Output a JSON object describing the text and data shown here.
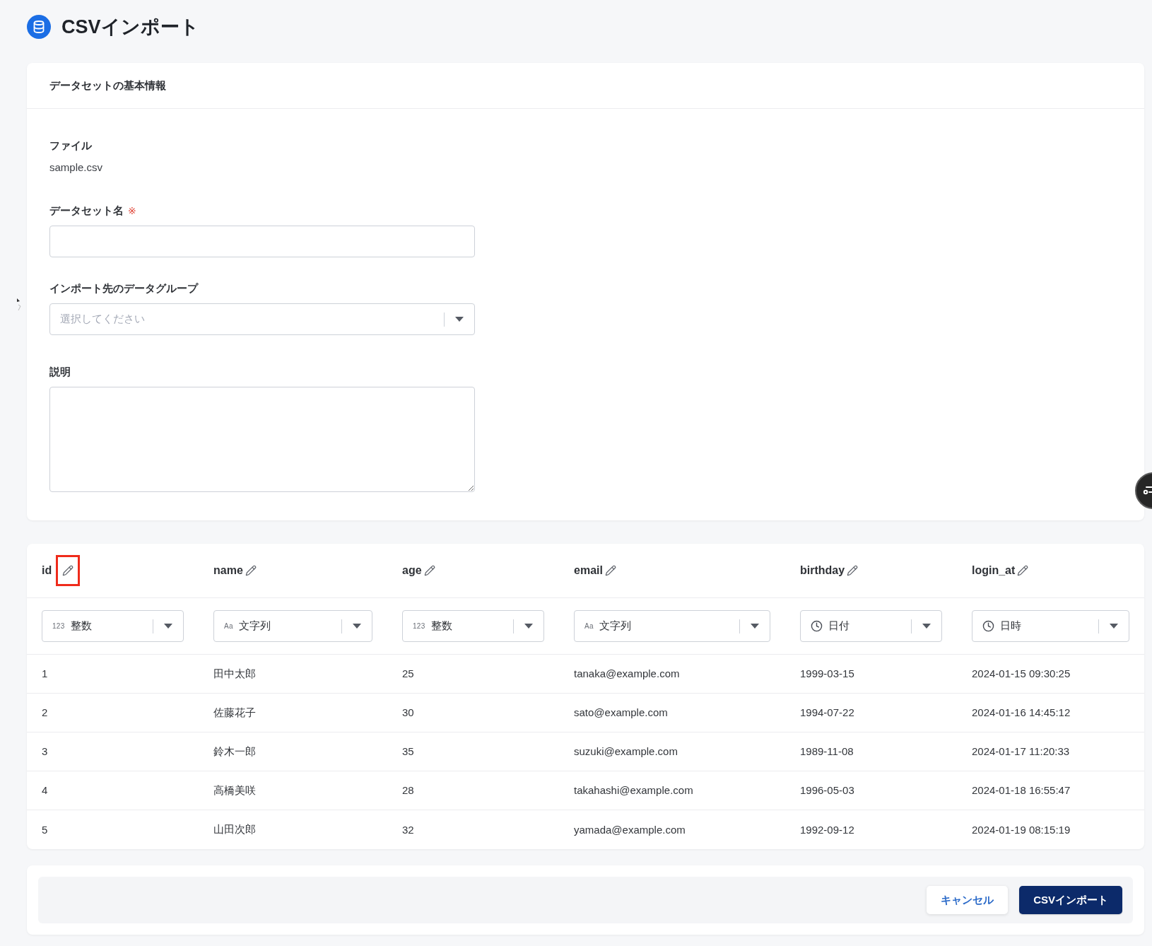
{
  "page": {
    "title": "CSVインポート"
  },
  "basic_info": {
    "heading": "データセットの基本情報",
    "file": {
      "label": "ファイル",
      "value": "sample.csv"
    },
    "dataset_name": {
      "label": "データセット名",
      "required_mark": "※"
    },
    "data_group": {
      "label": "インポート先のデータグループ",
      "placeholder": "選択してください"
    },
    "description": {
      "label": "説明"
    }
  },
  "table": {
    "columns": [
      {
        "name": "id",
        "highlighted": true,
        "type": {
          "kind": "glyph",
          "glyph": "123",
          "label": "整数"
        }
      },
      {
        "name": "name",
        "highlighted": false,
        "type": {
          "kind": "glyph",
          "glyph": "Aa",
          "label": "文字列"
        }
      },
      {
        "name": "age",
        "highlighted": false,
        "type": {
          "kind": "glyph",
          "glyph": "123",
          "label": "整数"
        }
      },
      {
        "name": "email",
        "highlighted": false,
        "type": {
          "kind": "glyph",
          "glyph": "Aa",
          "label": "文字列"
        }
      },
      {
        "name": "birthday",
        "highlighted": false,
        "type": {
          "kind": "clock",
          "label": "日付"
        }
      },
      {
        "name": "login_at",
        "highlighted": false,
        "type": {
          "kind": "clock",
          "label": "日時"
        }
      }
    ],
    "rows": [
      [
        "1",
        "田中太郎",
        "25",
        "tanaka@example.com",
        "1999-03-15",
        "2024-01-15 09:30:25"
      ],
      [
        "2",
        "佐藤花子",
        "30",
        "sato@example.com",
        "1994-07-22",
        "2024-01-16 14:45:12"
      ],
      [
        "3",
        "鈴木一郎",
        "35",
        "suzuki@example.com",
        "1989-11-08",
        "2024-01-17 11:20:33"
      ],
      [
        "4",
        "高橋美咲",
        "28",
        "takahashi@example.com",
        "1996-05-03",
        "2024-01-18 16:55:47"
      ],
      [
        "5",
        "山田次郎",
        "32",
        "yamada@example.com",
        "1992-09-12",
        "2024-01-19 08:15:19"
      ]
    ]
  },
  "actions": [
    {
      "label": "キャンセル",
      "kind": "secondary"
    },
    {
      "label": "CSVインポート",
      "kind": "primary"
    }
  ]
}
